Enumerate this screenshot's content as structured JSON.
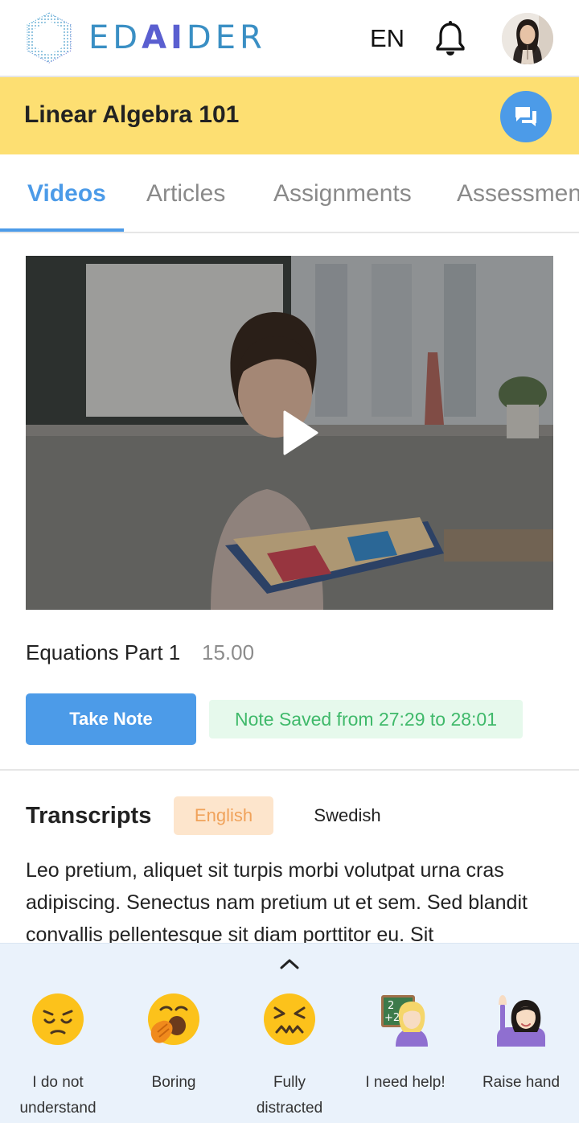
{
  "header": {
    "brand": {
      "prefix": "ED",
      "accent": "AI",
      "suffix": "DER"
    },
    "language": "EN"
  },
  "course": {
    "title": "Linear Algebra 101"
  },
  "tabs": [
    {
      "label": "Videos",
      "active": true
    },
    {
      "label": "Articles",
      "active": false
    },
    {
      "label": "Assignments",
      "active": false
    },
    {
      "label": "Assessmen",
      "active": false
    }
  ],
  "video": {
    "title": "Equations Part 1",
    "duration": "15.00"
  },
  "actions": {
    "take_note_label": "Take Note",
    "note_status": "Note Saved from 27:29 to 28:01"
  },
  "transcripts": {
    "title": "Transcripts",
    "languages": [
      "English",
      "Swedish"
    ],
    "selected_language": "English",
    "text": "Leo pretium, aliquet sit turpis morbi volutpat urna cras adipiscing. Senectus nam pretium ut et sem. Sed blandit convallis pellentesque sit diam porttitor eu. Sit"
  },
  "reactions": [
    {
      "icon": "pensive-face-icon",
      "label_line1": "I do not",
      "label_line2": "understand"
    },
    {
      "icon": "yawning-face-icon",
      "label_line1": "Boring",
      "label_line2": ""
    },
    {
      "icon": "confounded-face-icon",
      "label_line1": "Fully",
      "label_line2": "distracted"
    },
    {
      "icon": "teacher-icon",
      "label_line1": "I need help!",
      "label_line2": ""
    },
    {
      "icon": "raise-hand-icon",
      "label_line1": "Raise hand",
      "label_line2": ""
    }
  ],
  "colors": {
    "accent": "#4c9be8",
    "course_bar": "#fddf72",
    "note_saved_bg": "#e6f9ec",
    "note_saved_text": "#3fb96a",
    "english_pill_bg": "#fde5cc",
    "english_pill_text": "#f0a25a",
    "panel_bg": "#eaf2fb"
  }
}
